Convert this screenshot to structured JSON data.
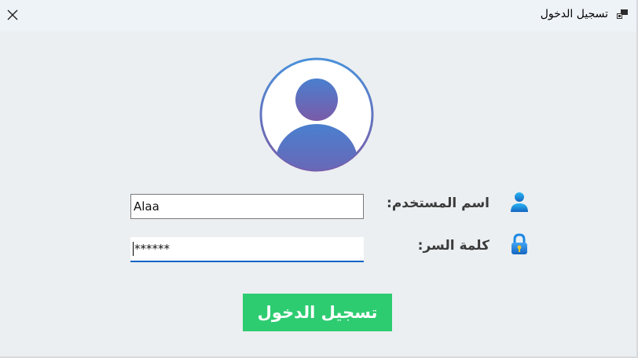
{
  "window": {
    "title": "تسجيل الدخول",
    "icon": "app-window-icon",
    "close_icon": "close-icon"
  },
  "avatar": {
    "icon": "user-avatar-icon",
    "ring_color_top": "#4a90d9",
    "ring_color_bottom": "#7a5ba8"
  },
  "form": {
    "username_label": "اسم المستخدم:",
    "username_icon": "user-icon",
    "username_value": "Alaa",
    "password_label": "كلمة السر:",
    "password_icon": "lock-icon",
    "password_value": "******"
  },
  "login_button": {
    "label": "تسجيل الدخول",
    "color": "#2ecc71"
  }
}
